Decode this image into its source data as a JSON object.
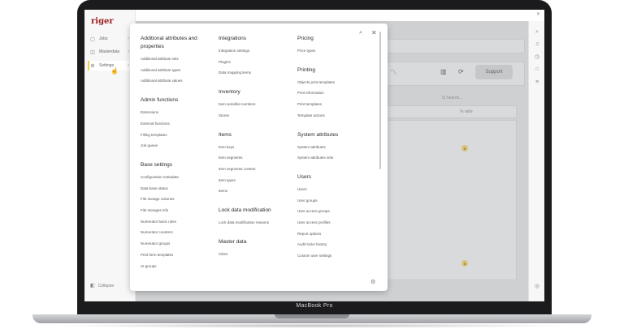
{
  "device": {
    "label": "MacBook Pro"
  },
  "app": {
    "logo": "riger",
    "sidebar": [
      {
        "label": "Jobs",
        "icon": "briefcase-icon",
        "glyph": "▢",
        "chevron": "›"
      },
      {
        "label": "Masterdata",
        "icon": "grid-icon",
        "glyph": "◫",
        "chevron": "›"
      },
      {
        "label": "Settings",
        "icon": "gear-icon",
        "glyph": "⚙",
        "chevron": "›"
      }
    ],
    "collapse_label": "Collapse",
    "collapse_glyph": "◧",
    "background": {
      "search_placeholder": "Q Search...",
      "column_total": "% ratio",
      "support_label": "Support",
      "badge_value": "8"
    }
  },
  "menu": {
    "columns": [
      [
        {
          "heading": "Additional attributes and properties",
          "items": [
            "Additional attribute sets",
            "Additional attribute types",
            "Additional attribute values"
          ]
        },
        {
          "heading": "Admin functions",
          "items": [
            "Extensions",
            "External functions",
            "Filling templates",
            "Job queue"
          ]
        },
        {
          "heading": "Base settings",
          "items": [
            "Configuration metadata",
            "Data base status",
            "File storage volumes",
            "File storages info",
            "Numerator basic rules",
            "Numerator counters",
            "Numerator groups",
            "Print form templates",
            "UI groups"
          ]
        }
      ],
      [
        {
          "heading": "Integrations",
          "items": [
            "Integration settings",
            "Plugins",
            "Data mapping items"
          ]
        },
        {
          "heading": "Inventory",
          "items": [
            "Item serial/lot numbers",
            "Stores"
          ]
        },
        {
          "heading": "Items",
          "items": [
            "Item keys",
            "Item segments",
            "Item segments content",
            "Item types",
            "Items"
          ]
        },
        {
          "heading": "Lock data modification",
          "items": [
            "Lock data modification reasons"
          ]
        },
        {
          "heading": "Master data",
          "items": [
            "Cities"
          ]
        }
      ],
      [
        {
          "heading": "Pricing",
          "items": [
            "Price types"
          ]
        },
        {
          "heading": "Printing",
          "items": [
            "Objects print templates",
            "Print information",
            "Print templates",
            "Template actions"
          ]
        },
        {
          "heading": "System attributes",
          "items": [
            "System attributes",
            "System attributes sets"
          ]
        },
        {
          "heading": "Users",
          "items": [
            "Users",
            "User groups",
            "User access groups",
            "User access profiles",
            "Report options",
            "Audit locks history",
            "Custom user settings"
          ]
        }
      ]
    ]
  }
}
